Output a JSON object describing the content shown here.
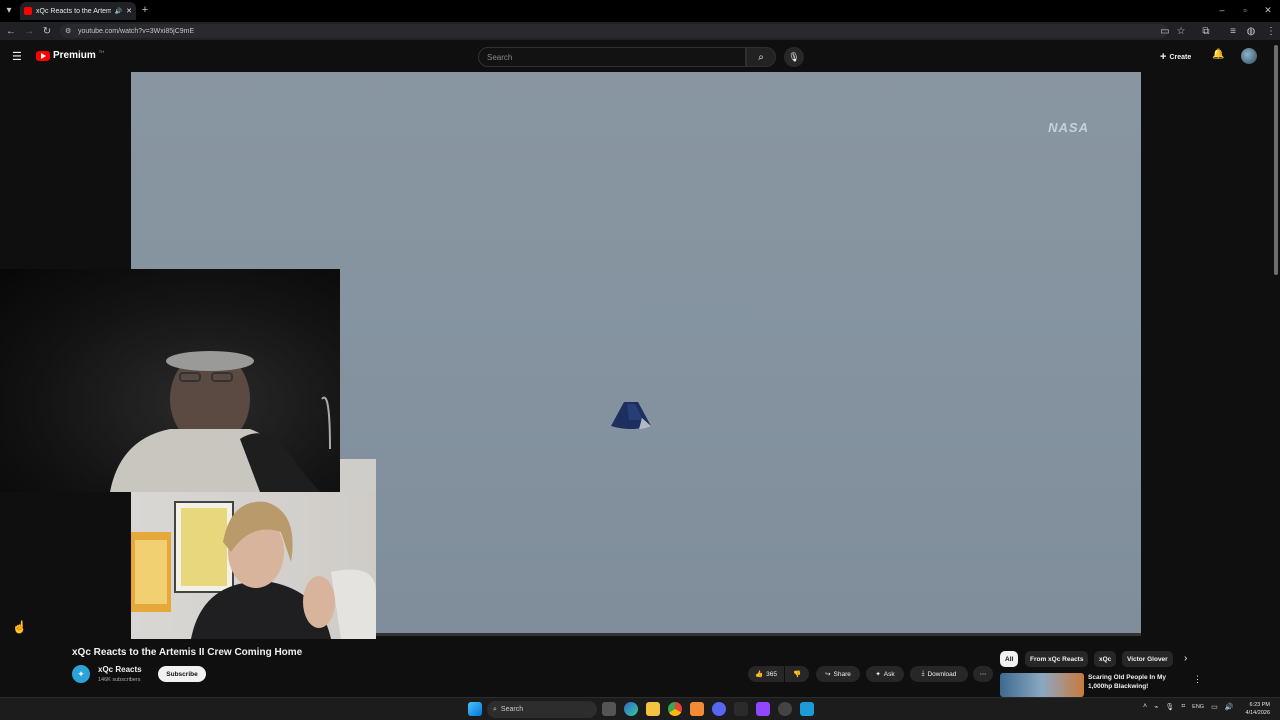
{
  "browser": {
    "tab_title": "xQc Reacts to the Artemis I",
    "url": "youtube.com/watch?v=3Wxi85jC9mE"
  },
  "youtube": {
    "brand": "Premium",
    "brand_sup": "TH",
    "search_placeholder": "Search",
    "create_label": "Create"
  },
  "video": {
    "watermark": "NASA",
    "title": "xQc Reacts to the Artemis II Crew Coming Home"
  },
  "channel": {
    "name": "xQc Reacts",
    "subscribers": "146K subscribers",
    "subscribe_label": "Subscribe"
  },
  "actions": {
    "likes": "365",
    "share": "Share",
    "ask": "Ask",
    "download": "Download"
  },
  "chips": [
    "All",
    "From xQc Reacts",
    "xQc",
    "Victor Glover"
  ],
  "recommendation": {
    "title": "Scaring Old People In My 1,000hp Blackwing!"
  },
  "taskbar": {
    "search_label": "Search",
    "lang": "ENG",
    "time": "6:23 PM",
    "date": "4/14/2026"
  },
  "colors": {
    "youtube_red": "#ff0000",
    "background": "#0f0f0f",
    "video_sky": "#8594a0"
  }
}
